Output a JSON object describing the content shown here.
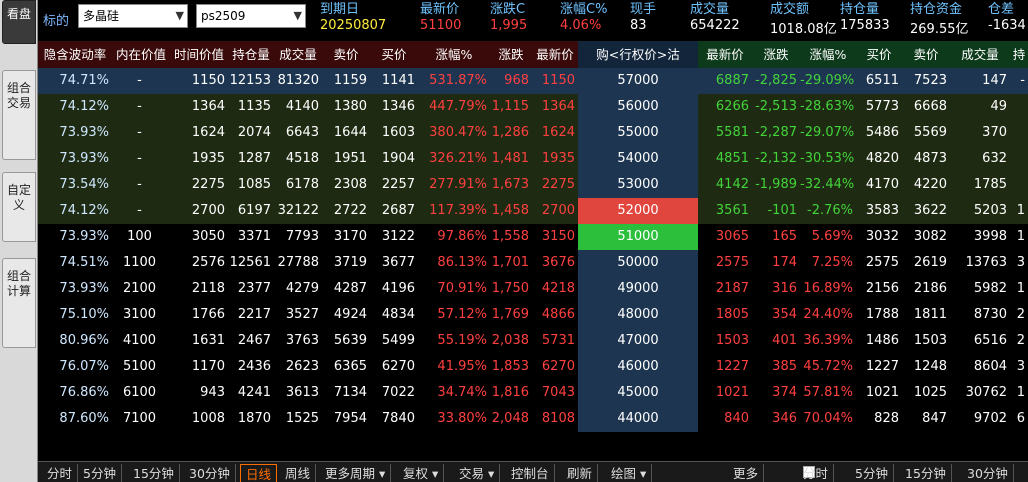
{
  "side_tabs": [
    "看盘",
    "组合交易",
    "自定义",
    "组合计算"
  ],
  "top": {
    "label": "标的",
    "underlying": "多晶硅",
    "contract": "ps2509",
    "fields": [
      {
        "k": "到期日",
        "v": "20250807",
        "c": "#ffeb3b"
      },
      {
        "k": "最新价",
        "v": "51100",
        "c": "#ff4040"
      },
      {
        "k": "涨跌C",
        "v": "1,995",
        "c": "#ff4040"
      },
      {
        "k": "涨幅C%",
        "v": "4.06%",
        "c": "#ff4040"
      },
      {
        "k": "现手",
        "v": "83",
        "c": "#ffffff"
      },
      {
        "k": "成交量",
        "v": "654222",
        "c": "#ffffff"
      },
      {
        "k": "成交额",
        "v": "1018.08亿",
        "c": "#ffffff"
      },
      {
        "k": "持仓量",
        "v": "175833",
        "c": "#ffffff"
      },
      {
        "k": "持仓资金",
        "v": "269.55亿",
        "c": "#ffffff"
      },
      {
        "k": "仓差",
        "v": "-1634",
        "c": "#ffffff"
      }
    ]
  },
  "headers": {
    "call": [
      "隐含波动率",
      "内在价值",
      "时间价值",
      "持仓量",
      "成交量",
      "卖价",
      "买价",
      "涨幅%",
      "涨跌",
      "最新价"
    ],
    "strike": "购<行权价>沽",
    "put": [
      "最新价",
      "涨跌",
      "涨幅%",
      "买价",
      "卖价",
      "成交量",
      "持"
    ]
  },
  "colors": {
    "call_itm_bg": "#1e2a12",
    "call_otm_bg": "#000000",
    "strike_bg": "#1d3550",
    "put_bg": "#000000",
    "row1_bg": "#1d3550",
    "atm_hi": "#e0463e",
    "atm_lo": "#2bbf3c",
    "up": "#ff4040",
    "down": "#43d43a",
    "neutral": "#ffffff"
  },
  "rows": [
    {
      "c": [
        "74.71%",
        "-",
        "1150",
        "12153",
        "81320",
        "1159",
        "1141",
        "531.87%",
        "968",
        "1150"
      ],
      "s": "57000",
      "p": [
        "6887",
        "-2,825",
        "-29.09%",
        "6511",
        "7523",
        "147",
        "-"
      ]
    },
    {
      "c": [
        "74.12%",
        "-",
        "1364",
        "1135",
        "4140",
        "1380",
        "1346",
        "447.79%",
        "1,115",
        "1364"
      ],
      "s": "56000",
      "p": [
        "6266",
        "-2,513",
        "-28.63%",
        "5773",
        "6668",
        "49",
        ""
      ]
    },
    {
      "c": [
        "73.93%",
        "-",
        "1624",
        "2074",
        "6643",
        "1644",
        "1603",
        "380.47%",
        "1,286",
        "1624"
      ],
      "s": "55000",
      "p": [
        "5581",
        "-2,287",
        "-29.07%",
        "5486",
        "5569",
        "370",
        ""
      ]
    },
    {
      "c": [
        "73.93%",
        "-",
        "1935",
        "1287",
        "4518",
        "1951",
        "1904",
        "326.21%",
        "1,481",
        "1935"
      ],
      "s": "54000",
      "p": [
        "4851",
        "-2,132",
        "-30.53%",
        "4820",
        "4873",
        "632",
        ""
      ]
    },
    {
      "c": [
        "73.54%",
        "-",
        "2275",
        "1085",
        "6178",
        "2308",
        "2257",
        "277.91%",
        "1,673",
        "2275"
      ],
      "s": "53000",
      "p": [
        "4142",
        "-1,989",
        "-32.44%",
        "4170",
        "4220",
        "1785",
        ""
      ]
    },
    {
      "c": [
        "74.12%",
        "-",
        "2700",
        "6197",
        "32122",
        "2722",
        "2687",
        "117.39%",
        "1,458",
        "2700"
      ],
      "s": "52000",
      "p": [
        "3561",
        "-101",
        "-2.76%",
        "3583",
        "3622",
        "5203",
        "1"
      ]
    },
    {
      "c": [
        "73.93%",
        "100",
        "3050",
        "3371",
        "7793",
        "3170",
        "3122",
        "97.86%",
        "1,558",
        "3150"
      ],
      "s": "51000",
      "p": [
        "3065",
        "165",
        "5.69%",
        "3032",
        "3082",
        "3998",
        "1"
      ]
    },
    {
      "c": [
        "74.51%",
        "1100",
        "2576",
        "12561",
        "27788",
        "3719",
        "3677",
        "86.13%",
        "1,701",
        "3676"
      ],
      "s": "50000",
      "p": [
        "2575",
        "174",
        "7.25%",
        "2575",
        "2619",
        "13763",
        "3"
      ]
    },
    {
      "c": [
        "73.93%",
        "2100",
        "2118",
        "2377",
        "4279",
        "4287",
        "4196",
        "70.91%",
        "1,750",
        "4218"
      ],
      "s": "49000",
      "p": [
        "2187",
        "316",
        "16.89%",
        "2156",
        "2186",
        "5982",
        "1"
      ]
    },
    {
      "c": [
        "75.10%",
        "3100",
        "1766",
        "2217",
        "3527",
        "4924",
        "4834",
        "57.12%",
        "1,769",
        "4866"
      ],
      "s": "48000",
      "p": [
        "1805",
        "354",
        "24.40%",
        "1788",
        "1811",
        "8730",
        "2"
      ]
    },
    {
      "c": [
        "80.96%",
        "4100",
        "1631",
        "2467",
        "3763",
        "5639",
        "5499",
        "55.19%",
        "2,038",
        "5731"
      ],
      "s": "47000",
      "p": [
        "1503",
        "401",
        "36.39%",
        "1486",
        "1503",
        "6516",
        "2"
      ]
    },
    {
      "c": [
        "76.07%",
        "5100",
        "1170",
        "2436",
        "2623",
        "6365",
        "6270",
        "41.95%",
        "1,853",
        "6270"
      ],
      "s": "46000",
      "p": [
        "1227",
        "385",
        "45.72%",
        "1227",
        "1248",
        "8604",
        "3"
      ]
    },
    {
      "c": [
        "76.86%",
        "6100",
        "943",
        "4241",
        "3613",
        "7134",
        "7022",
        "34.74%",
        "1,816",
        "7043"
      ],
      "s": "45000",
      "p": [
        "1021",
        "374",
        "57.81%",
        "1021",
        "1025",
        "30762",
        "1"
      ]
    },
    {
      "c": [
        "87.60%",
        "7100",
        "1008",
        "1870",
        "1525",
        "7954",
        "7840",
        "33.80%",
        "2,048",
        "8108"
      ],
      "s": "44000",
      "p": [
        "840",
        "346",
        "70.04%",
        "828",
        "847",
        "9702",
        "6"
      ]
    }
  ],
  "bottom_left": [
    "分时",
    "5分钟",
    "15分钟",
    "30分钟",
    "日线",
    "周线",
    "更多周期 ▾",
    "复权 ▾",
    "交易 ▾",
    "控制台",
    "刷新",
    "绘图 ▾"
  ],
  "bottom_more": "更多",
  "bottom_right": [
    "分时",
    "5分钟",
    "15分钟",
    "30分钟"
  ],
  "bottom_active": "日线"
}
